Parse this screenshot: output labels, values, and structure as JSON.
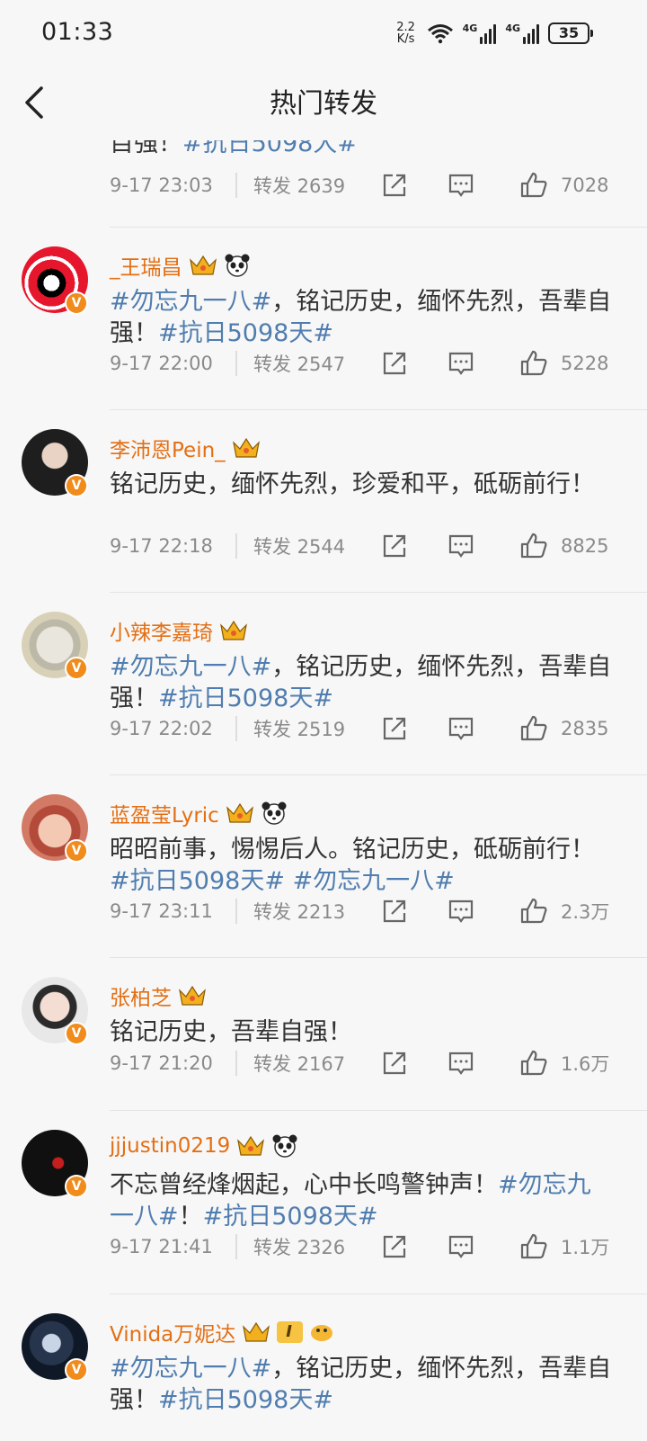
{
  "status": {
    "time": "01:33",
    "speed_value": "2.2",
    "speed_unit": "K/s",
    "sig1": "4G",
    "sig2": "4G",
    "battery": "35"
  },
  "header": {
    "title": "热门转发"
  },
  "partial": {
    "text": "目强！",
    "tag": "#抗日5098大#",
    "time": "9-17 23:03",
    "repost": "转发 2639",
    "likes": "7028"
  },
  "items": [
    {
      "user": "_王瑞昌",
      "segments": [
        [
          "#勿忘九一八#",
          true
        ],
        [
          "，铭记历史，缅怀先烈，吾辈自强！",
          false
        ],
        [
          "#抗日5098天#",
          true
        ]
      ],
      "time": "9-17 22:00",
      "repost": "转发 2547",
      "likes": "5228"
    },
    {
      "user": "李沛恩Pein_",
      "segments": [
        [
          "铭记历史，缅怀先烈，珍爱和平，砥砺前行！",
          false
        ]
      ],
      "time": "9-17 22:18",
      "repost": "转发 2544",
      "likes": "8825"
    },
    {
      "user": "小辣李嘉琦",
      "segments": [
        [
          "#勿忘九一八#",
          true
        ],
        [
          "，铭记历史，缅怀先烈，吾辈自强！",
          false
        ],
        [
          "#抗日5098天#",
          true
        ]
      ],
      "time": "9-17 22:02",
      "repost": "转发 2519",
      "likes": "2835"
    },
    {
      "user": "蓝盈莹Lyric",
      "segments": [
        [
          "昭昭前事，惕惕后人。铭记历史，砥砺前行！",
          false
        ],
        [
          "#抗日5098天#",
          true
        ],
        [
          " ",
          false
        ],
        [
          "#勿忘九一八#",
          true
        ]
      ],
      "time": "9-17 23:11",
      "repost": "转发 2213",
      "likes": "2.3万"
    },
    {
      "user": "张柏芝",
      "segments": [
        [
          "铭记历史，吾辈自强！",
          false
        ]
      ],
      "time": "9-17 21:20",
      "repost": "转发 2167",
      "likes": "1.6万"
    },
    {
      "user": "jjjustin0219",
      "segments": [
        [
          "不忘曾经烽烟起，心中长鸣警钟声！",
          false
        ],
        [
          "#勿忘九一八#",
          true
        ],
        [
          "！",
          false
        ],
        [
          "#抗日5098天#",
          true
        ]
      ],
      "time": "9-17 21:41",
      "repost": "转发 2326",
      "likes": "1.1万"
    },
    {
      "user": "Vinida万妮达",
      "level": "I",
      "segments": [
        [
          "#勿忘九一八#",
          true
        ],
        [
          "，铭记历史，缅怀先烈，吾辈自强！",
          false
        ],
        [
          "#抗日5098天#",
          true
        ]
      ]
    }
  ],
  "colors": {
    "accent": "#e36f14",
    "tag": "#507daf",
    "badge": "#f08b1c"
  }
}
